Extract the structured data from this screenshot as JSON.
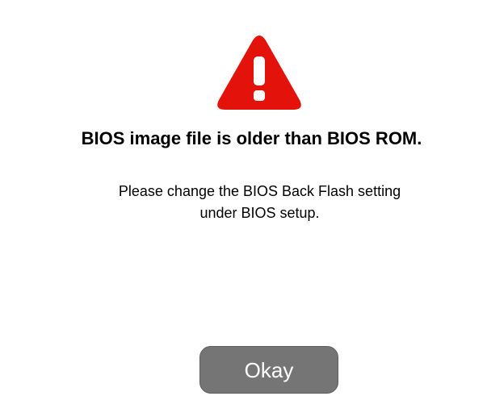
{
  "dialog": {
    "icon": "warning-triangle-icon",
    "icon_color": "#e3120b",
    "title": "BIOS image file is older than BIOS ROM.",
    "message_lines": [
      "Please change the BIOS Back Flash setting",
      "under BIOS setup."
    ],
    "ok_label": "Okay",
    "button_color": "#757575"
  }
}
